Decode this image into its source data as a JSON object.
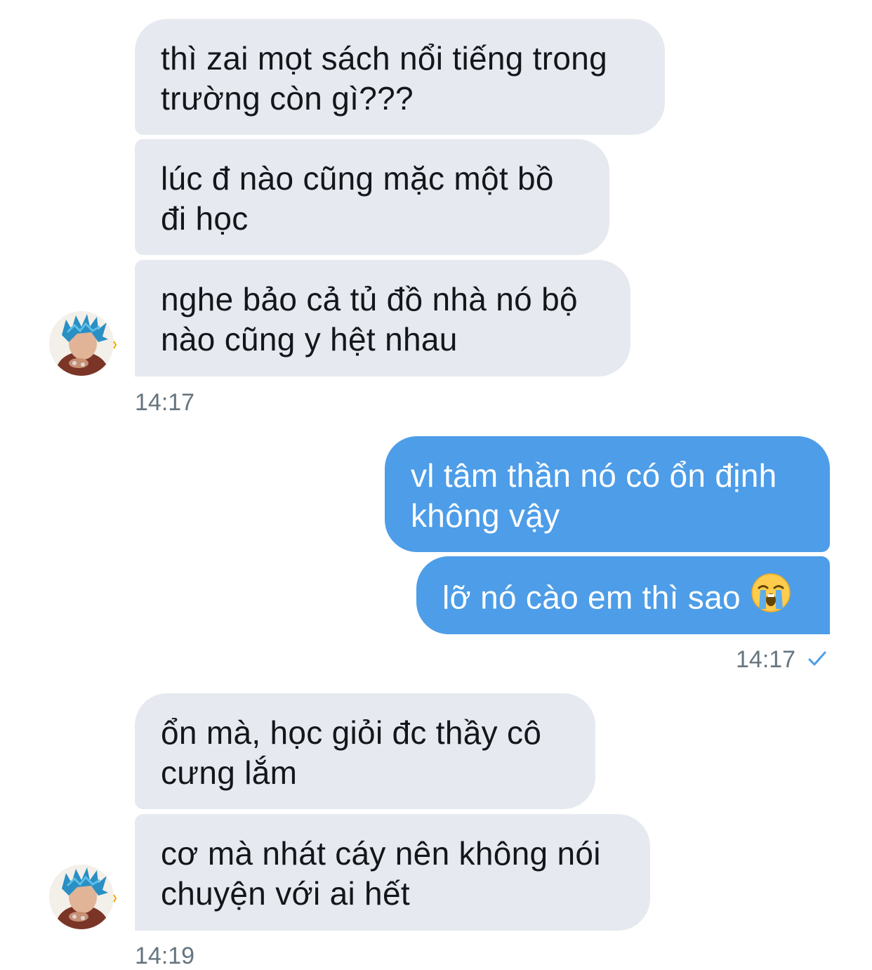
{
  "messages": [
    {
      "text": "thì zai mọt sách nổi tiếng trong trường còn gì???"
    },
    {
      "text": "lúc đ nào cũng mặc một bồ đi học"
    },
    {
      "text": "nghe bảo cả tủ đồ nhà nó bộ nào cũng y hệt nhau"
    },
    {
      "text": "vl tâm thần nó có ổn định không vậy"
    },
    {
      "text": "lỡ nó cào em thì sao"
    },
    {
      "text": "ổn mà, học giỏi đc thầy cô cưng lắm"
    },
    {
      "text": "cơ mà nhát cáy nên không nói chuyện với ai hết"
    }
  ],
  "timestamps": {
    "group1": "14:17",
    "group2": "14:17",
    "group3": "14:19"
  },
  "icons": {
    "read_receipt": "checkmark-icon",
    "emoji": "loudly-crying-face-icon",
    "avatar": "contact-avatar"
  },
  "colors": {
    "incoming_bubble": "#e6e9f0",
    "outgoing_bubble": "#4d9de8",
    "timestamp": "#66757f",
    "check": "#4d9de8"
  }
}
